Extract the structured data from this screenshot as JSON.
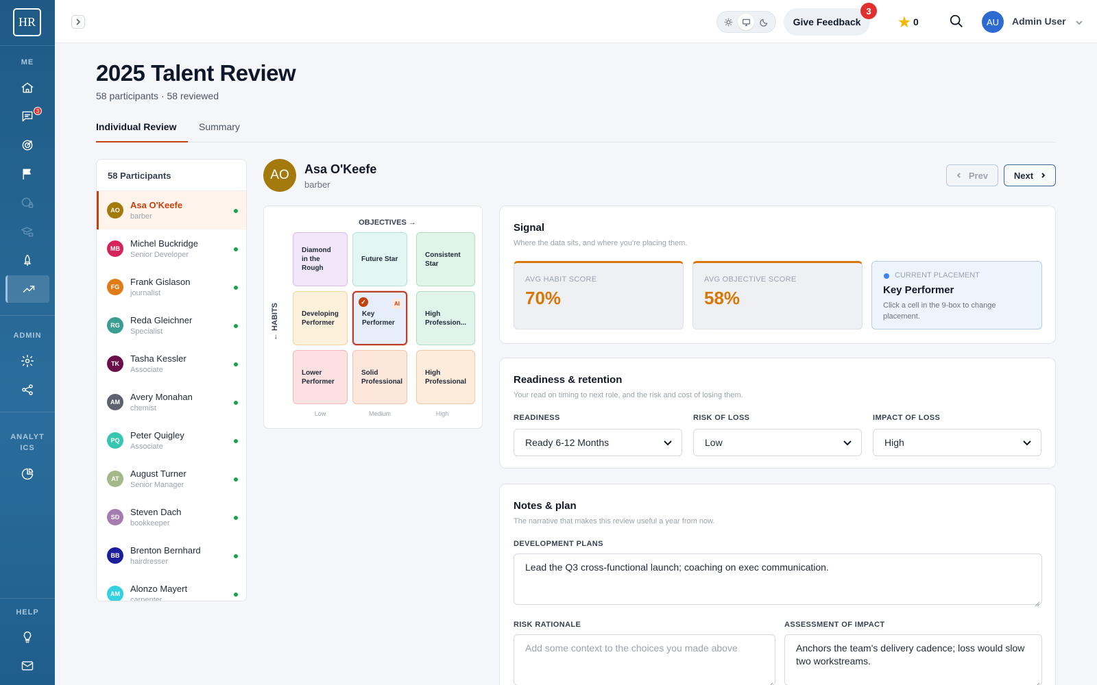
{
  "app": {
    "logo": "HR"
  },
  "sidebar": {
    "sections": [
      {
        "label": "ME"
      },
      {
        "label": "ADMIN"
      },
      {
        "label": "ANALYT ICS"
      },
      {
        "label": "HELP"
      }
    ],
    "badge_messages": "3"
  },
  "topbar": {
    "feedback_label": "Give Feedback",
    "feedback_badge": "3",
    "stars_count": "0",
    "user_initials": "AU",
    "user_name": "Admin User"
  },
  "page": {
    "title": "2025 Talent Review",
    "subtitle": "58 participants · 58 reviewed",
    "tabs": [
      "Individual Review",
      "Summary"
    ]
  },
  "participants": {
    "header": "58 Participants",
    "items": [
      {
        "initials": "AO",
        "name": "Asa O'Keefe",
        "role": "barber",
        "color": "#a47a0d"
      },
      {
        "initials": "MB",
        "name": "Michel Buckridge",
        "role": "Senior Developer",
        "color": "#d6245a"
      },
      {
        "initials": "FG",
        "name": "Frank Gislason",
        "role": "journalist",
        "color": "#e07b16"
      },
      {
        "initials": "RG",
        "name": "Reda Gleichner",
        "role": "Specialist",
        "color": "#3a9e93"
      },
      {
        "initials": "TK",
        "name": "Tasha Kessler",
        "role": "Associate",
        "color": "#6b0f4a"
      },
      {
        "initials": "AM",
        "name": "Avery Monahan",
        "role": "chemist",
        "color": "#5d6170"
      },
      {
        "initials": "PQ",
        "name": "Peter Quigley",
        "role": "Associate",
        "color": "#37c7b0"
      },
      {
        "initials": "AT",
        "name": "August Turner",
        "role": "Senior Manager",
        "color": "#a3b98a"
      },
      {
        "initials": "SD",
        "name": "Steven Dach",
        "role": "bookkeeper",
        "color": "#a57bb0"
      },
      {
        "initials": "BB",
        "name": "Brenton Bernhard",
        "role": "hairdresser",
        "color": "#1d1e9c"
      },
      {
        "initials": "AM",
        "name": "Alonzo Mayert",
        "role": "carpenter",
        "color": "#34d1e0"
      }
    ]
  },
  "person": {
    "initials": "AO",
    "name": "Asa O'Keefe",
    "role": "barber",
    "prev_label": "Prev",
    "next_label": "Next"
  },
  "ninebox": {
    "top_label": "OBJECTIVES →",
    "side_label": "← HABITS",
    "axis": [
      "Low",
      "Medium",
      "High"
    ],
    "ai_label": "AI",
    "check": "✓",
    "cells": [
      {
        "label": "Diamond in the Rough",
        "bg": "#f2e6fb",
        "border": "#d7bdea"
      },
      {
        "label": "Future Star",
        "bg": "#e2f6f2",
        "border": "#b3e3d8"
      },
      {
        "label": "Consistent Star",
        "bg": "#e0f4e8",
        "border": "#afdcbe"
      },
      {
        "label": "Developing Performer",
        "bg": "#fdf1dc",
        "border": "#f1d59d"
      },
      {
        "label": "Key Performer",
        "bg": "#e7eefb",
        "border": "#b83f2a"
      },
      {
        "label": "High Profession...",
        "bg": "#e0f4ec",
        "border": "#aedcc6"
      },
      {
        "label": "Lower Performer",
        "bg": "#fbe1e1",
        "border": "#f0b9b9"
      },
      {
        "label": "Solid Professional",
        "bg": "#fde7dc",
        "border": "#f1c4ac"
      },
      {
        "label": "High Professional",
        "bg": "#fdebdb",
        "border": "#f1c9a6"
      }
    ]
  },
  "signal": {
    "title": "Signal",
    "subtitle": "Where the data sits, and where you're placing them.",
    "habit_label": "AVG HABIT SCORE",
    "habit_value": "70%",
    "objective_label": "AVG OBJECTIVE SCORE",
    "objective_value": "58%",
    "placement_label": "CURRENT PLACEMENT",
    "placement_value": "Key Performer",
    "placement_help": "Click a cell in the 9-box to change placement."
  },
  "readiness": {
    "title": "Readiness & retention",
    "subtitle": "Your read on timing to next role, and the risk and cost of losing them.",
    "readiness_label": "READINESS",
    "readiness_value": "Ready 6-12 Months",
    "risk_label": "RISK OF LOSS",
    "risk_value": "Low",
    "impact_label": "IMPACT OF LOSS",
    "impact_value": "High"
  },
  "notes": {
    "title": "Notes & plan",
    "subtitle": "The narrative that makes this review useful a year from now.",
    "dev_label": "DEVELOPMENT PLANS",
    "dev_value": "Lead the Q3 cross-functional launch; coaching on exec communication.",
    "risk_label": "RISK RATIONALE",
    "risk_placeholder": "Add some context to the choices you made above",
    "impact_label": "ASSESSMENT OF IMPACT",
    "impact_value": "Anchors the team's delivery cadence; loss would slow two workstreams."
  }
}
